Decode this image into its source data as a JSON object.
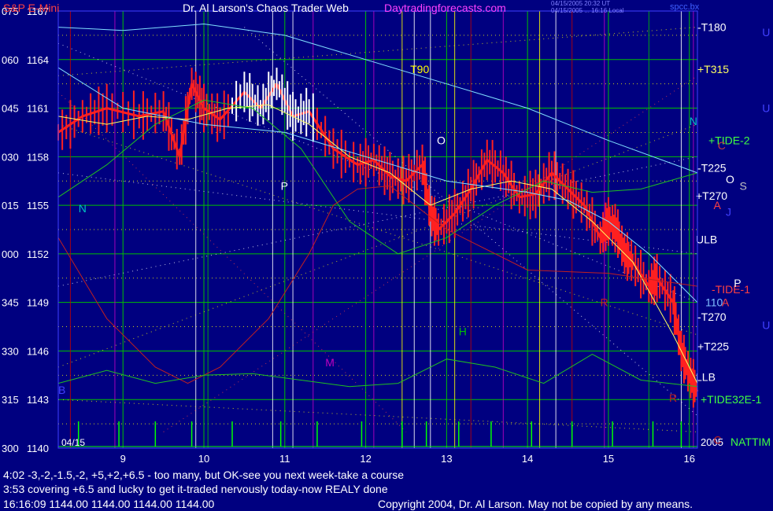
{
  "header": {
    "symbol": "S&P E-Mini",
    "title": "Dr. Al Larson's Chaos Trader Web",
    "site": "Daytradingforecasts.com",
    "stamp1": "04/15/2005 20:32 UT",
    "stamp2": "04/15/2005 ... 16:16 Local",
    "corner": "spcc.bx"
  },
  "colors": {
    "background": "#000080",
    "grid_green": "#00c000",
    "grid_yellow": "#ffff00",
    "grid_white": "#ffffff",
    "grid_magenta": "#c000c0",
    "grid_red": "#c00000",
    "price_bar": "#ff2020",
    "spike": "#00ff00",
    "avg_yellow": "#ffff60",
    "avg_cyan": "#80e0ff",
    "header_title": "#ffffff",
    "header_site": "#ff40ff"
  },
  "chart_data": {
    "type": "line",
    "xlabel": "",
    "ylabel": "",
    "date_label": "04/15",
    "year_label": "2005",
    "ylim": [
      1140,
      1167
    ],
    "xlim": [
      8.2,
      16.1
    ],
    "x_ticks": [
      9,
      10,
      11,
      12,
      13,
      14,
      15,
      16
    ],
    "y_ticks": [
      {
        "angle": "075",
        "price": 1167
      },
      {
        "angle": "060",
        "price": 1164
      },
      {
        "angle": "045",
        "price": 1161
      },
      {
        "angle": "030",
        "price": 1158
      },
      {
        "angle": "015",
        "price": 1155
      },
      {
        "angle": "000",
        "price": 1152
      },
      {
        "angle": "345",
        "price": 1149
      },
      {
        "angle": "330",
        "price": 1146
      },
      {
        "angle": "315",
        "price": 1143
      },
      {
        "angle": "300",
        "price": 1140
      }
    ],
    "series": [
      {
        "kind": "price",
        "x": [
          8.2,
          8.5,
          8.8,
          9.2,
          9.5,
          9.7,
          9.85,
          10.0,
          10.2,
          10.5,
          10.7,
          10.9,
          11.1,
          11.3,
          11.6,
          11.9,
          12.1,
          12.3,
          12.5,
          12.7,
          12.8,
          12.9,
          13.1,
          13.3,
          13.5,
          13.7,
          13.9,
          14.1,
          14.3,
          14.5,
          14.7,
          14.9,
          15.0,
          15.1,
          15.2,
          15.3,
          15.5,
          15.6,
          15.8,
          15.9,
          16.0,
          16.1
        ],
        "y": [
          1159.5,
          1160.5,
          1161.0,
          1160.5,
          1160.8,
          1158.0,
          1162.5,
          1161.0,
          1160.3,
          1162.0,
          1161.0,
          1162.5,
          1160.5,
          1160.8,
          1158.5,
          1157.5,
          1157.8,
          1156.8,
          1156.5,
          1157.5,
          1154.5,
          1153.5,
          1154.5,
          1156.0,
          1157.8,
          1157.0,
          1155.5,
          1155.7,
          1157.0,
          1156.0,
          1155.0,
          1153.0,
          1154.0,
          1153.5,
          1152.0,
          1151.5,
          1150.0,
          1150.5,
          1149.0,
          1146.0,
          1144.5,
          1143.5
        ]
      },
      {
        "kind": "average",
        "color": "yellow",
        "x": [
          8.2,
          8.8,
          9.3,
          9.8,
          10.3,
          10.8,
          11.3,
          11.8,
          12.3,
          12.8,
          13.3,
          13.8,
          14.3,
          14.8,
          15.3,
          15.8,
          16.1
        ],
        "y": [
          1160.5,
          1160.0,
          1160.5,
          1160.3,
          1161.0,
          1161.2,
          1160.0,
          1158.0,
          1157.0,
          1155.0,
          1156.0,
          1156.5,
          1156.0,
          1154.0,
          1151.5,
          1147.0,
          1144.0
        ]
      },
      {
        "kind": "average",
        "color": "green",
        "x": [
          8.2,
          8.8,
          9.4,
          10.0,
          10.6,
          11.2,
          11.8,
          12.4,
          13.0,
          13.6,
          14.2,
          14.8,
          15.4,
          16.1
        ],
        "y": [
          1155.5,
          1157.5,
          1160.0,
          1161.5,
          1161.0,
          1158.5,
          1154.0,
          1152.0,
          1153.0,
          1155.0,
          1156.5,
          1155.8,
          1156.0,
          1157.0
        ]
      },
      {
        "kind": "average",
        "color": "cyan",
        "x": [
          8.2,
          9.0,
          10.0,
          11.0,
          12.0,
          13.0,
          14.0,
          14.5,
          15.0,
          15.5,
          16.1
        ],
        "y": [
          1163.5,
          1161.0,
          1160.0,
          1159.5,
          1158.0,
          1156.5,
          1155.8,
          1155.3,
          1154.0,
          1152.0,
          1149.0
        ]
      },
      {
        "kind": "average",
        "color": "cyan",
        "x": [
          8.2,
          9.0,
          10.0,
          11.0,
          12.0,
          13.0,
          14.0,
          15.0,
          16.1
        ],
        "y": [
          1166.0,
          1165.8,
          1166.2,
          1165.5,
          1164.0,
          1162.5,
          1161.0,
          1159.0,
          1157.0
        ]
      },
      {
        "kind": "average",
        "color": "red",
        "x": [
          8.2,
          8.8,
          9.4,
          9.8,
          10.2,
          10.8,
          11.3,
          11.6,
          11.9,
          12.3,
          13.0,
          14.0,
          15.0,
          16.1
        ],
        "y": [
          1153.0,
          1148.0,
          1145.0,
          1144.0,
          1145.0,
          1148.0,
          1152.0,
          1155.0,
          1156.0,
          1156.2,
          1153.5,
          1151.0,
          1150.8,
          1150.0
        ]
      },
      {
        "kind": "average",
        "color": "green",
        "x": [
          8.2,
          8.8,
          9.4,
          10.0,
          10.6,
          11.2,
          11.8,
          12.4,
          13.0,
          13.6,
          14.2,
          14.8,
          15.4,
          16.1
        ],
        "y": [
          1144.0,
          1144.8,
          1144.0,
          1144.5,
          1144.6,
          1144.2,
          1143.8,
          1144.0,
          1145.5,
          1145.0,
          1144.0,
          1145.8,
          1144.2,
          1143.8
        ]
      }
    ],
    "right_labels": [
      "-T180",
      "+T315",
      "+TIDE-2",
      "-T225",
      "+T270",
      "ULB",
      "-TIDE-1",
      "-T270",
      "+T225",
      "LLB",
      "+TIDE32E-1",
      "NATTIM",
      "110"
    ],
    "plot_letters": [
      "N",
      "P",
      "O",
      "T90",
      "H",
      "M",
      "R",
      "R",
      "N",
      "C",
      "O",
      "S",
      "J",
      "P",
      "A",
      "U",
      "U",
      "U",
      "B",
      "C",
      "A"
    ]
  },
  "notes": {
    "line1": "4:02 -3,-2,-1.5,-2, +5,+2,+6.5 - too many, but OK-see you next week-take a course",
    "line2": "3:53 covering +6.5 and lucky to get it-traded nervously today-now REALY done",
    "quote": "16:16:09  1144.00 1144.00 1144.00 1144.00",
    "copyright": "Copyright 2004, Dr. Al Larson. May not be copied by any means."
  }
}
